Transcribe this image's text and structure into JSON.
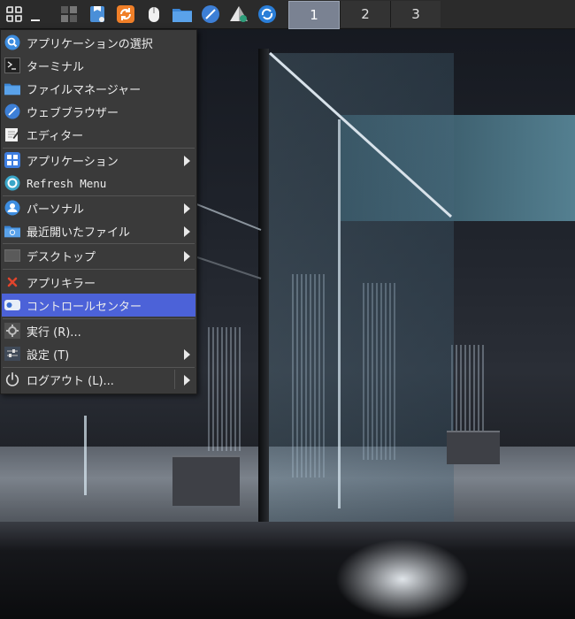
{
  "panel": {
    "launchers": [
      {
        "icon": "app-menu-icon"
      },
      {
        "icon": "show-desktop-icon"
      },
      {
        "icon": "workspace-icon"
      },
      {
        "icon": "package-icon"
      },
      {
        "icon": "update-icon"
      },
      {
        "icon": "mouse-icon"
      },
      {
        "icon": "folder-icon"
      },
      {
        "icon": "browser-icon"
      },
      {
        "icon": "drive-icon"
      },
      {
        "icon": "refresh-icon"
      }
    ],
    "workspaces": [
      "1",
      "2",
      "3"
    ],
    "active_workspace": "1"
  },
  "menu": {
    "items": [
      {
        "label": "アプリケーションの選択",
        "icon": "search-icon"
      },
      {
        "label": "ターミナル",
        "icon": "terminal-icon"
      },
      {
        "label": "ファイルマネージャー",
        "icon": "folder-icon"
      },
      {
        "label": "ウェブブラウザー",
        "icon": "browser-icon"
      },
      {
        "label": "エディター",
        "icon": "editor-icon"
      },
      {
        "label": "アプリケーション",
        "icon": "apps-icon",
        "submenu": true
      },
      {
        "label": "Refresh Menu",
        "icon": "refresh-icon"
      },
      {
        "label": "パーソナル",
        "icon": "user-icon",
        "submenu": true
      },
      {
        "label": "最近開いたファイル",
        "icon": "recent-folder-icon",
        "submenu": true
      },
      {
        "label": "デスクトップ",
        "icon": "desktop-icon",
        "submenu": true
      },
      {
        "label": "アプリキラー",
        "icon": "kill-icon"
      },
      {
        "label": "コントロールセンター",
        "icon": "toggle-icon",
        "highlighted": true
      },
      {
        "label": "実行 (R)...",
        "icon": "run-icon"
      },
      {
        "label": "設定 (T)",
        "icon": "settings-icon",
        "submenu": true
      },
      {
        "label": "ログアウト (L)...",
        "icon": "power-icon",
        "submenu": true
      }
    ]
  },
  "colors": {
    "highlight": "#4c62d8",
    "menu_bg": "#3a3a3a",
    "panel_bg": "#2b2b2b",
    "active_workspace": "#7a8292"
  }
}
